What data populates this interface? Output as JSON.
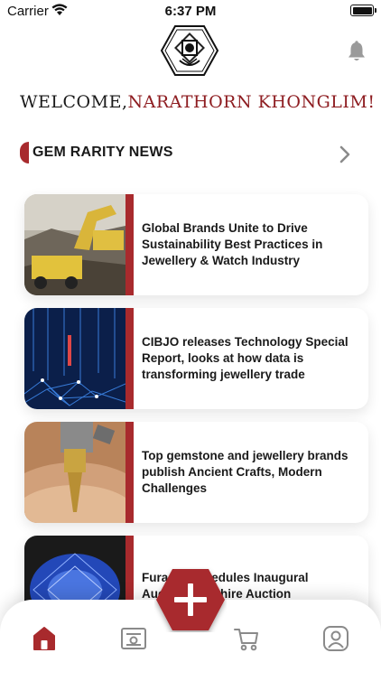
{
  "status_bar": {
    "carrier": "Carrier",
    "time": "6:37 PM"
  },
  "header": {
    "welcome_prefix": "WELCOME,",
    "user_name": "NARATHORN KHONGLIM!"
  },
  "section": {
    "title": "GEM RARITY NEWS"
  },
  "news": [
    {
      "title": "Global Brands Unite to Drive Sustainability Best Practices in Jewellery & Watch Industry",
      "image": "mining-trucks"
    },
    {
      "title": "CIBJO releases Technology Special Report, looks at how data is transforming jewellery trade",
      "image": "data-network"
    },
    {
      "title": "Top gemstone and jewellery brands publish Ancient Crafts, Modern Challenges",
      "image": "gem-polishing"
    },
    {
      "title": "Furacol Schedules Inaugural Auction Sapphire Auction",
      "image": "blue-sapphire"
    }
  ],
  "bottom_nav": {
    "items": [
      "home-icon",
      "certificate-icon",
      "cart-icon",
      "profile-icon"
    ],
    "active": "home-icon",
    "fab_icon": "plus-icon"
  },
  "colors": {
    "accent": "#a82a2d",
    "brand_dark": "#8e1d21"
  }
}
